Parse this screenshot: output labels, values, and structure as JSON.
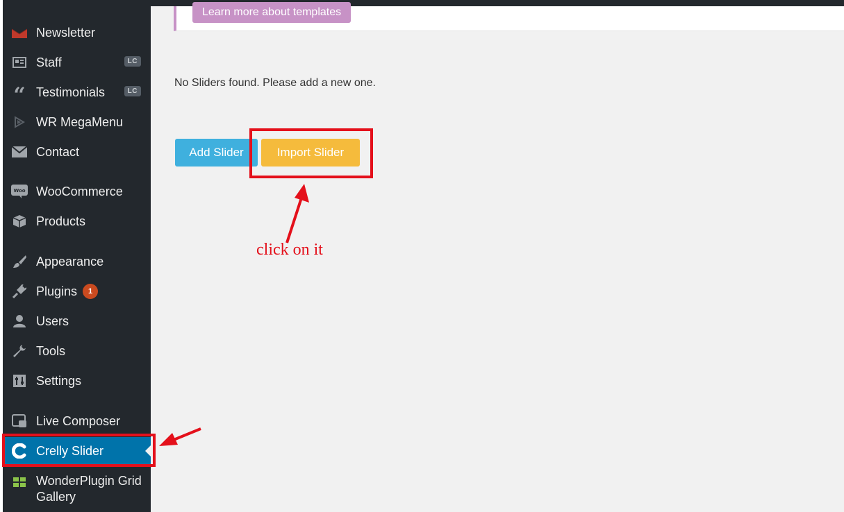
{
  "sidebar": {
    "items": [
      {
        "label": "Newsletter",
        "icon": "envelope-open-icon"
      },
      {
        "label": "Staff",
        "icon": "id-card-icon",
        "badge": "LC"
      },
      {
        "label": "Testimonials",
        "icon": "quote-icon",
        "badge": "LC"
      },
      {
        "label": "WR MegaMenu",
        "icon": "megamenu-icon"
      },
      {
        "label": "Contact",
        "icon": "mail-icon"
      },
      {
        "label": "WooCommerce",
        "icon": "woo-icon"
      },
      {
        "label": "Products",
        "icon": "box-icon"
      },
      {
        "label": "Appearance",
        "icon": "paintbrush-icon"
      },
      {
        "label": "Plugins",
        "icon": "plug-icon",
        "count": "1"
      },
      {
        "label": "Users",
        "icon": "user-icon"
      },
      {
        "label": "Tools",
        "icon": "wrench-icon"
      },
      {
        "label": "Settings",
        "icon": "sliders-icon"
      },
      {
        "label": "Live Composer",
        "icon": "composer-icon"
      },
      {
        "label": "Crelly Slider",
        "icon": "crelly-c-icon",
        "active": true
      },
      {
        "label": "WonderPlugin Grid Gallery",
        "icon": "grid-icon"
      }
    ]
  },
  "main": {
    "templates_button": "Learn more about templates",
    "empty_message": "No Sliders found. Please add a new one.",
    "add_slider": "Add Slider",
    "import_slider": "Import Slider"
  },
  "annotation": {
    "text": "click on it",
    "color": "#e4101b"
  },
  "colors": {
    "sidebar_bg": "#23282d",
    "active_bg": "#0073aa",
    "add_btn": "#3fb0de",
    "import_btn": "#f5bb3c",
    "template_accent": "#c792c6"
  }
}
